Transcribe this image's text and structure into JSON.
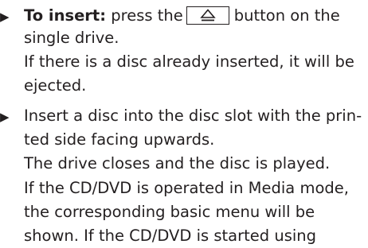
{
  "instructions": {
    "step1": {
      "bullet": "▶",
      "label": "To insert:",
      "text_before_button": "press the",
      "button_icon": "eject-icon",
      "text_after_button": "button on the",
      "line2": "single drive.",
      "note_line1": "If there is a disc already inserted, it will be",
      "note_line2": "ejected."
    },
    "step2": {
      "bullet": "▶",
      "line1": "Insert a disc into the disc slot with the prin-",
      "line2": "ted side facing upwards.",
      "line3": "The drive closes and the disc is played.",
      "line4": "If the CD/DVD is operated in Media mode,",
      "line5": "the corresponding basic menu will be",
      "line6": "shown. If the CD/DVD is started using"
    }
  }
}
